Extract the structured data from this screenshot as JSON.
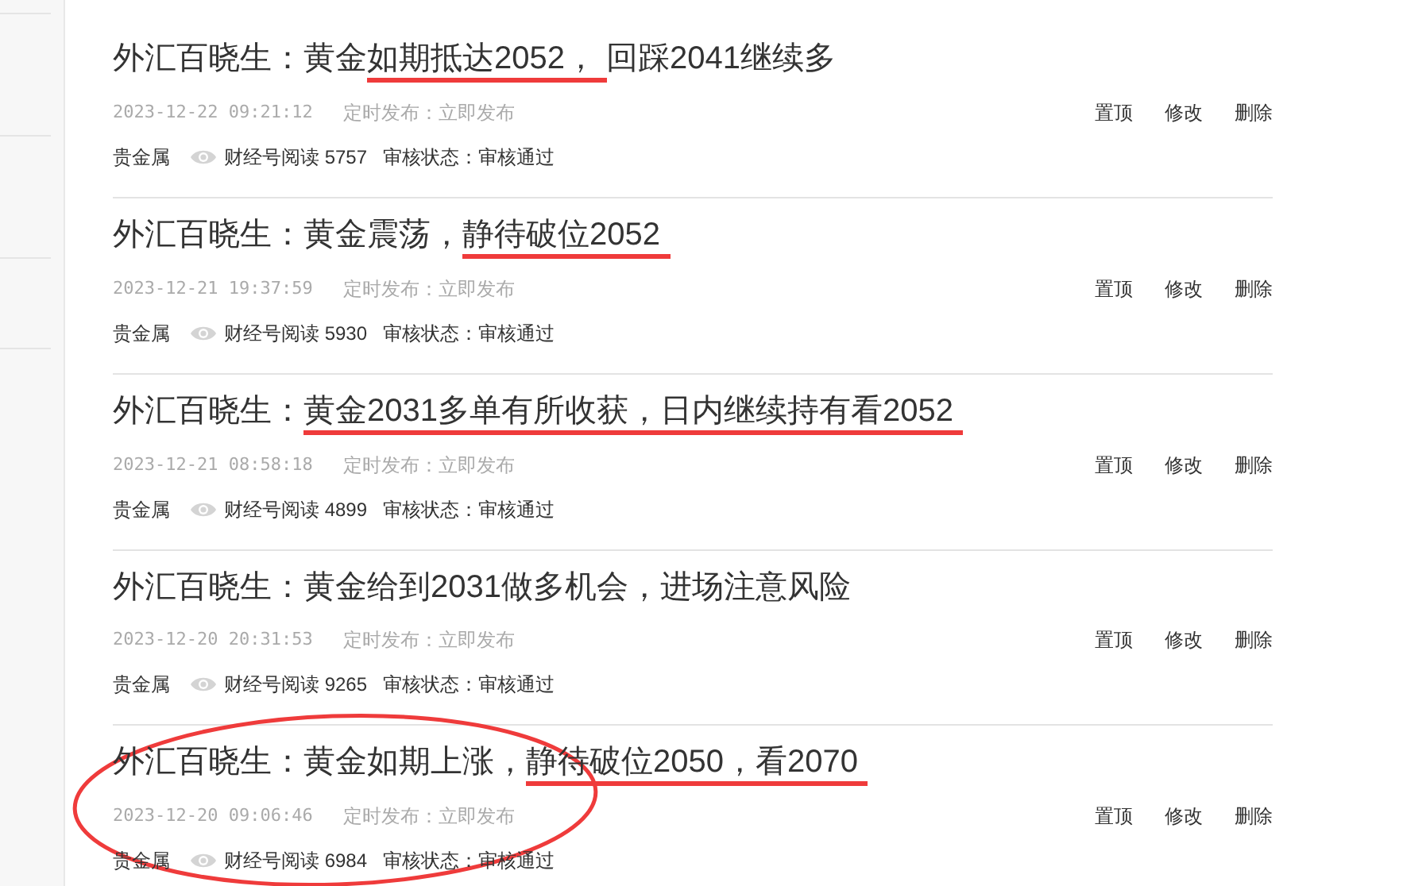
{
  "articles": [
    {
      "title": [
        {
          "text": "外汇百晓生：黄金",
          "underlined": false
        },
        {
          "text": "如期抵达2052，",
          "underlined": true
        },
        {
          "text": "回踩2041继续多",
          "underlined": false
        }
      ],
      "time": "2023-12-22 09:21:12",
      "schedule": "定时发布：立即发布",
      "category": "贵金属",
      "reads": "财经号阅读 5757",
      "review": "审核状态：审核通过",
      "actions": [
        "置顶",
        "修改",
        "删除"
      ],
      "circled": false
    },
    {
      "title": [
        {
          "text": "外汇百晓生：黄金震荡，",
          "underlined": false
        },
        {
          "text": "静待破位2052",
          "underlined": true
        }
      ],
      "time": "2023-12-21 19:37:59",
      "schedule": "定时发布：立即发布",
      "category": "贵金属",
      "reads": "财经号阅读 5930",
      "review": "审核状态：审核通过",
      "actions": [
        "置顶",
        "修改",
        "删除"
      ],
      "circled": false
    },
    {
      "title": [
        {
          "text": "外汇百晓生：",
          "underlined": false
        },
        {
          "text": "黄金2031多单有所收获，日内继续持有看2052",
          "underlined": true
        }
      ],
      "time": "2023-12-21 08:58:18",
      "schedule": "定时发布：立即发布",
      "category": "贵金属",
      "reads": "财经号阅读 4899",
      "review": "审核状态：审核通过",
      "actions": [
        "置顶",
        "修改",
        "删除"
      ],
      "circled": false
    },
    {
      "title": [
        {
          "text": "外汇百晓生：黄金给到2031做多机会，进场注意风险",
          "underlined": false
        }
      ],
      "time": "2023-12-20 20:31:53",
      "schedule": "定时发布：立即发布",
      "category": "贵金属",
      "reads": "财经号阅读 9265",
      "review": "审核状态：审核通过",
      "actions": [
        "置顶",
        "修改",
        "删除"
      ],
      "circled": false
    },
    {
      "title": [
        {
          "text": "外汇百晓生：黄金如期上涨，",
          "underlined": false
        },
        {
          "text": "静待破位2050，看2070",
          "underlined": true
        }
      ],
      "time": "2023-12-20 09:06:46",
      "schedule": "定时发布：立即发布",
      "category": "贵金属",
      "reads": "财经号阅读 6984",
      "review": "审核状态：审核通过",
      "actions": [
        "置顶",
        "修改",
        "删除"
      ],
      "circled": true
    }
  ]
}
